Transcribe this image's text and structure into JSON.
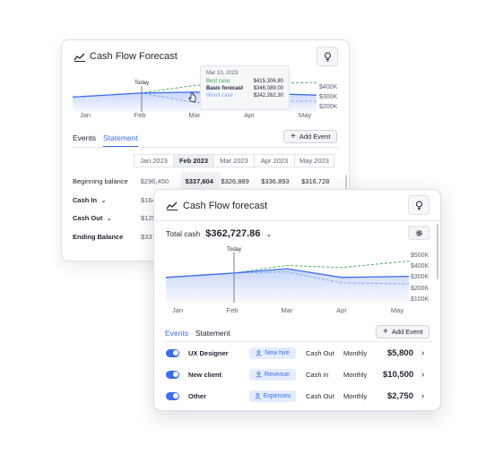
{
  "colors": {
    "accent": "#3b6df0",
    "best_case": "#34a853",
    "worst_case": "#7aa0f7",
    "tag_bg": "#e4ecff"
  },
  "back_card": {
    "title": "Cash Flow Forecast",
    "title_icon": "chart-icon",
    "bulb_icon": "lightbulb-icon",
    "chart": {
      "x_labels": [
        "Jan",
        "Feb",
        "Mar",
        "Apr",
        "May"
      ],
      "y_labels": [
        "$400K",
        "$300K",
        "$200K"
      ],
      "marker_label": "Today",
      "basic_forecast": [
        296450,
        337604,
        346089,
        336893,
        316728
      ],
      "best_case": [
        296450,
        337604,
        415306.8,
        430000,
        445000
      ],
      "worst_case": [
        296450,
        337604,
        242262.3,
        250000,
        255000
      ]
    },
    "tooltip": {
      "date": "Mar 10, 2023",
      "rows": [
        {
          "label": "Best case",
          "value": "$415,306.80"
        },
        {
          "label": "Basic forecast",
          "value": "$346,089.00"
        },
        {
          "label": "Worst case",
          "value": "$242,262.30"
        }
      ]
    },
    "tabs": [
      "Events",
      "Statement"
    ],
    "active_tab": "Statement",
    "add_event_label": "Add Event",
    "months": [
      "Jan 2023",
      "Feb 2023",
      "Mar 2023",
      "Apr 2023",
      "May 2023"
    ],
    "selected_month": "Feb 2023",
    "rows": [
      {
        "label": "Beginning balance",
        "values": [
          "$296,450",
          "$337,604",
          "$326,889",
          "$336,893",
          "$316,728"
        ]
      },
      {
        "label": "Cash In",
        "values": [
          "$164"
        ]
      },
      {
        "label": "Cash Out",
        "values": [
          "$125"
        ]
      },
      {
        "label": "Ending Balance",
        "values": [
          "$337"
        ]
      }
    ]
  },
  "front_card": {
    "title": "Cash Flow forecast",
    "title_icon": "chart-icon",
    "bulb_icon": "lightbulb-icon",
    "total_label": "Total cash",
    "total_value": "$362,727.86",
    "settings_icon": "gear-icon",
    "chart": {
      "x_labels": [
        "Jan",
        "Feb",
        "Mar",
        "Apr",
        "May"
      ],
      "y_labels": [
        "$500K",
        "$400K",
        "$300K",
        "$200K",
        "$100K"
      ],
      "marker_label": "Today",
      "basic_forecast": [
        290000,
        330000,
        370000,
        290000,
        300000
      ],
      "best_case": [
        290000,
        330000,
        400000,
        380000,
        440000
      ],
      "worst_case": [
        290000,
        330000,
        340000,
        240000,
        230000
      ]
    },
    "tabs": [
      "Events",
      "Statement"
    ],
    "active_tab": "Events",
    "add_event_label": "Add Event",
    "events": [
      {
        "name": "UX Designer",
        "tag": "New hire",
        "type": "Cash Out",
        "frequency": "Monthly",
        "amount": "$5,800"
      },
      {
        "name": "New client",
        "tag": "Revenue",
        "type": "Cash in",
        "frequency": "Monthly",
        "amount": "$10,500"
      },
      {
        "name": "Other",
        "tag": "Expenses",
        "type": "Cash Out",
        "frequency": "Monthly",
        "amount": "$2,750"
      }
    ]
  }
}
